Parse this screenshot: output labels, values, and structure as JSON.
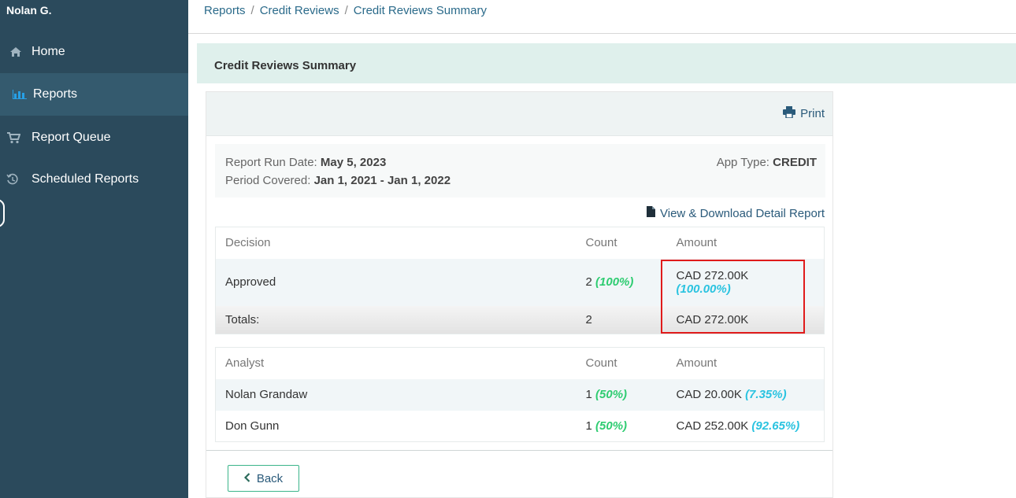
{
  "sidebar": {
    "user": "Nolan G.",
    "items": [
      {
        "label": "Home",
        "icon": "home-icon"
      },
      {
        "label": "Reports",
        "icon": "bar-chart-icon",
        "active": true
      },
      {
        "label": "Report Queue",
        "icon": "cart-icon"
      },
      {
        "label": "Scheduled Reports",
        "icon": "history-icon"
      }
    ]
  },
  "breadcrumb": [
    "Reports",
    "Credit Reviews",
    "Credit Reviews Summary"
  ],
  "breadcrumb_sep": "/",
  "panel": {
    "title": "Credit Reviews Summary"
  },
  "toolbar": {
    "print_label": "Print"
  },
  "meta": {
    "run_date_label": "Report Run Date:",
    "run_date_value": "May 5, 2023",
    "period_label": "Period Covered:",
    "period_value": "Jan 1, 2021 - Jan 1, 2022",
    "app_type_label": "App Type:",
    "app_type_value": "CREDIT"
  },
  "detail_link": "View & Download Detail Report",
  "decision_table": {
    "headers": [
      "Decision",
      "Count",
      "Amount"
    ],
    "rows": [
      {
        "decision": "Approved",
        "count": "2",
        "count_pct": "(100%)",
        "amount": "CAD 272.00K",
        "amount_pct": "(100.00%)"
      }
    ],
    "totals": {
      "label": "Totals:",
      "count": "2",
      "amount": "CAD 272.00K"
    }
  },
  "analyst_table": {
    "headers": [
      "Analyst",
      "Count",
      "Amount"
    ],
    "rows": [
      {
        "analyst": "Nolan Grandaw",
        "count": "1",
        "count_pct": "(50%)",
        "amount": "CAD 20.00K",
        "amount_pct": "(7.35%)"
      },
      {
        "analyst": "Don Gunn",
        "count": "1",
        "count_pct": "(50%)",
        "amount": "CAD 252.00K",
        "amount_pct": "(92.65%)"
      }
    ]
  },
  "back_label": "Back",
  "colors": {
    "sidebar": "#2b4a5c",
    "accent": "#27a0e6",
    "green_pct": "#2ecc71",
    "cyan_pct": "#2ac3e0",
    "highlight": "#e01b1b"
  }
}
